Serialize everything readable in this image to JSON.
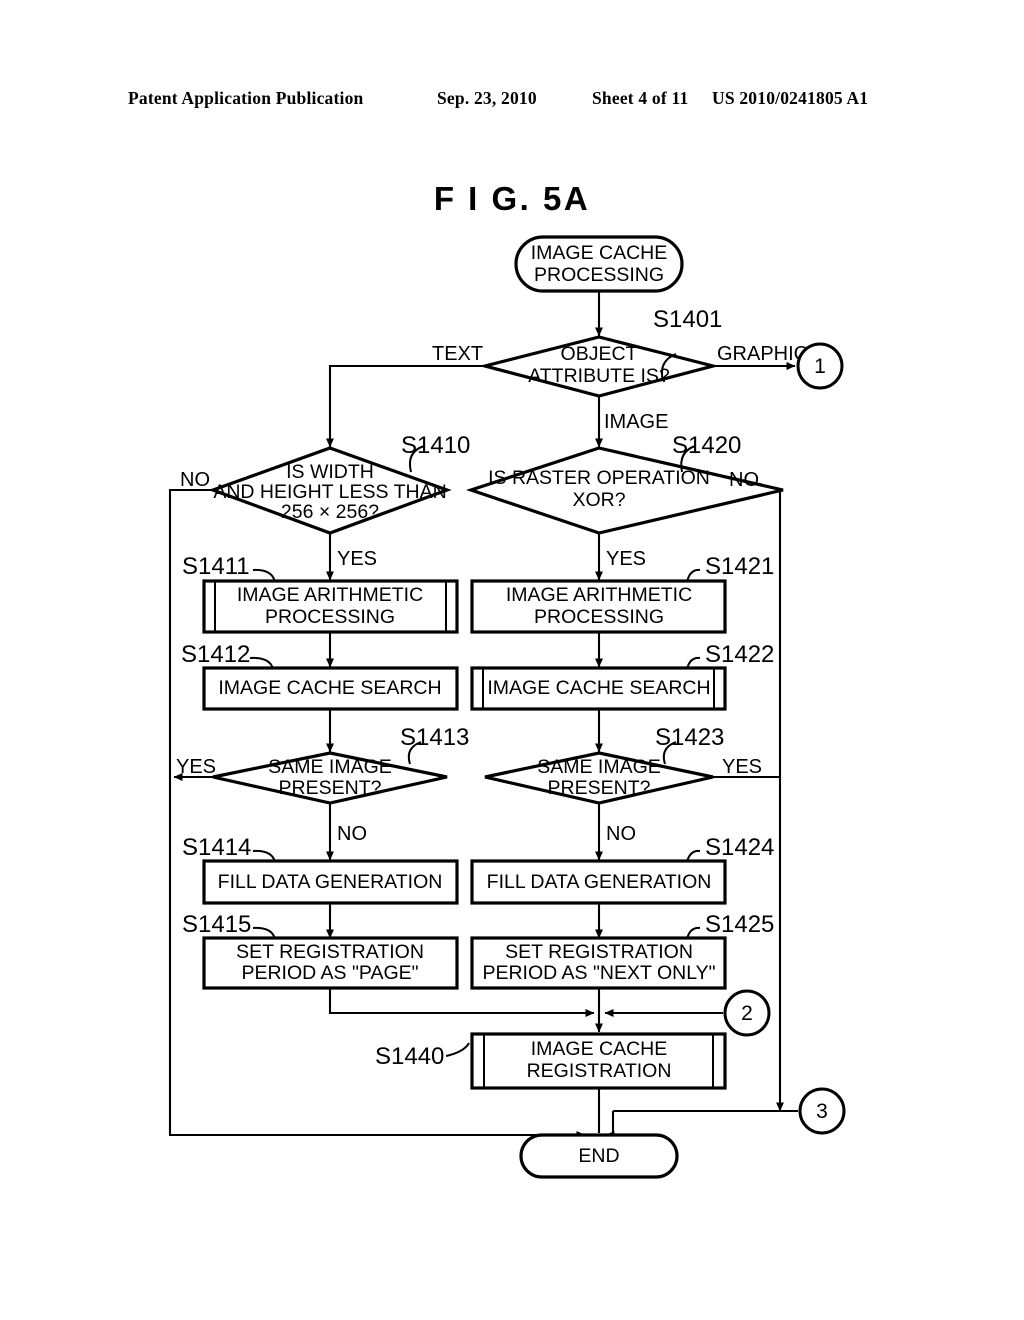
{
  "header": {
    "publication": "Patent Application Publication",
    "date": "Sep. 23, 2010",
    "sheet": "Sheet 4 of 11",
    "number": "US 2010/0241805 A1"
  },
  "figure": {
    "title": "F I G.  5A"
  },
  "colors": {
    "ink": "#000000",
    "paper": "#ffffff"
  },
  "flowchart": {
    "type": "flowchart",
    "nodes": {
      "start": {
        "id": "",
        "shape": "terminator",
        "text_line1": "IMAGE CACHE",
        "text_line2": "PROCESSING"
      },
      "s1401": {
        "id": "S1401",
        "shape": "decision",
        "text_line1": "OBJECT",
        "text_line2": "ATTRIBUTE IS?"
      },
      "s1410": {
        "id": "S1410",
        "shape": "decision",
        "text_line1": "IS WIDTH",
        "text_line2": "AND HEIGHT LESS THAN",
        "text_line3": "256 × 256?"
      },
      "s1411": {
        "id": "S1411",
        "shape": "predefined-process",
        "text_line1": "IMAGE ARITHMETIC",
        "text_line2": "PROCESSING"
      },
      "s1412": {
        "id": "S1412",
        "shape": "process",
        "text_line1": "IMAGE CACHE SEARCH"
      },
      "s1413": {
        "id": "S1413",
        "shape": "decision",
        "text_line1": "SAME IMAGE",
        "text_line2": "PRESENT?"
      },
      "s1414": {
        "id": "S1414",
        "shape": "process",
        "text_line1": "FILL DATA GENERATION"
      },
      "s1415": {
        "id": "S1415",
        "shape": "process",
        "text_line1": "SET REGISTRATION",
        "text_line2": "PERIOD AS \"PAGE\""
      },
      "s1420": {
        "id": "S1420",
        "shape": "decision",
        "text_line1": "IS RASTER OPERATION",
        "text_line2": "XOR?"
      },
      "s1421": {
        "id": "S1421",
        "shape": "process",
        "text_line1": "IMAGE ARITHMETIC",
        "text_line2": "PROCESSING"
      },
      "s1422": {
        "id": "S1422",
        "shape": "predefined-process",
        "text_line1": "IMAGE CACHE SEARCH"
      },
      "s1423": {
        "id": "S1423",
        "shape": "decision",
        "text_line1": "SAME IMAGE",
        "text_line2": "PRESENT?"
      },
      "s1424": {
        "id": "S1424",
        "shape": "process",
        "text_line1": "FILL DATA GENERATION"
      },
      "s1425": {
        "id": "S1425",
        "shape": "process",
        "text_line1": "SET REGISTRATION",
        "text_line2": "PERIOD AS \"NEXT ONLY\""
      },
      "s1440": {
        "id": "S1440",
        "shape": "predefined-process",
        "text_line1": "IMAGE CACHE",
        "text_line2": "REGISTRATION"
      },
      "end": {
        "id": "",
        "shape": "terminator",
        "text_line1": "END"
      }
    },
    "branch_labels": {
      "s1401_text": "TEXT",
      "s1401_graphic": "GRAPHIC",
      "s1401_image": "IMAGE",
      "s1410_no": "NO",
      "s1410_yes": "YES",
      "s1413_yes": "YES",
      "s1413_no": "NO",
      "s1420_no": "NO",
      "s1420_yes": "YES",
      "s1423_yes": "YES",
      "s1423_no": "NO"
    },
    "connectors": {
      "one": "1",
      "two": "2",
      "three": "3"
    }
  }
}
